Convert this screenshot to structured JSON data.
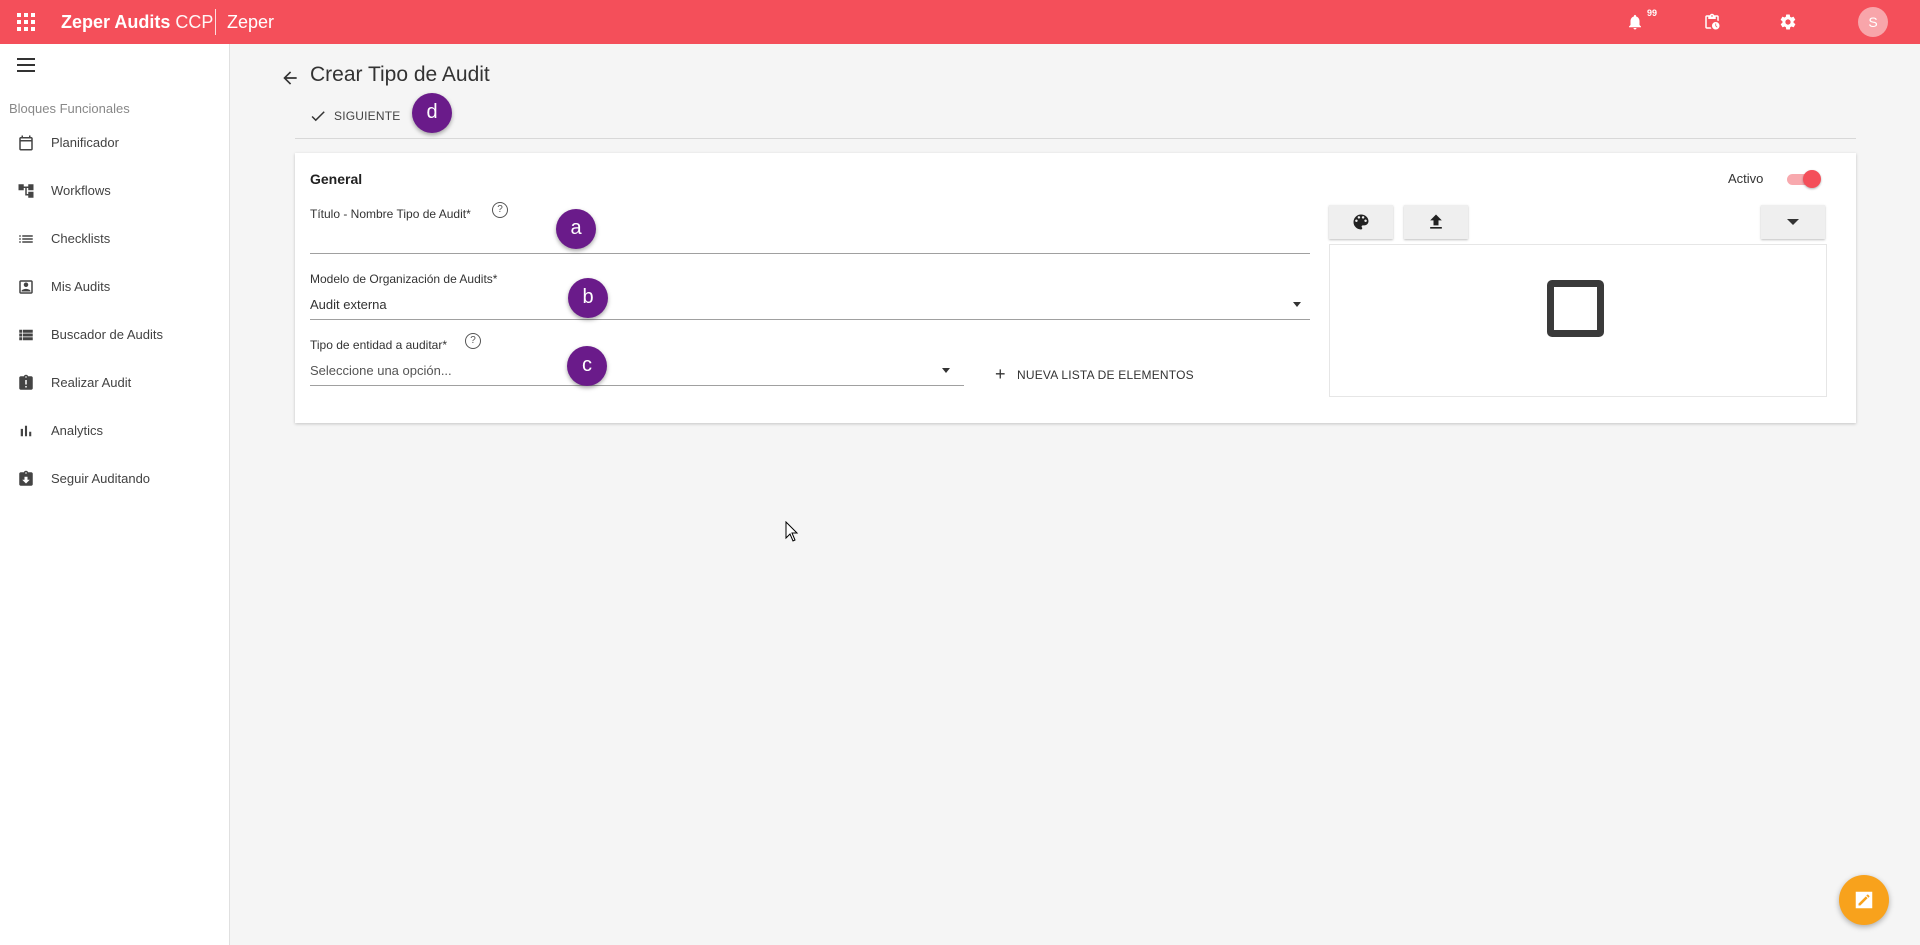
{
  "topbar": {
    "brand_bold": "Zeper Audits",
    "brand_suffix": "CCP",
    "org": "Zeper",
    "notification_count": "99",
    "avatar_initial": "S"
  },
  "sidebar": {
    "section_title": "Bloques Funcionales",
    "items": [
      {
        "label": "Planificador",
        "icon": "calendar-icon"
      },
      {
        "label": "Workflows",
        "icon": "workflow-icon"
      },
      {
        "label": "Checklists",
        "icon": "list-icon"
      },
      {
        "label": "Mis Audits",
        "icon": "contact-card-icon"
      },
      {
        "label": "Buscador de Audits",
        "icon": "search-list-icon"
      },
      {
        "label": "Realizar Audit",
        "icon": "clipboard-alert-icon"
      },
      {
        "label": "Analytics",
        "icon": "bar-chart-icon"
      },
      {
        "label": "Seguir Auditando",
        "icon": "clipboard-download-icon"
      }
    ]
  },
  "page": {
    "title": "Crear Tipo de Audit",
    "next_label": "SIGUIENTE"
  },
  "card": {
    "title": "General",
    "active_label": "Activo",
    "active": true,
    "fields": {
      "title": {
        "label": "Título - Nombre Tipo de Audit*",
        "value": ""
      },
      "model": {
        "label": "Modelo de Organización de Audits*",
        "value": "Audit externa"
      },
      "entity": {
        "label": "Tipo de entidad a auditar*",
        "placeholder": "Seleccione una opción..."
      }
    },
    "new_list_label": "NUEVA LISTA DE ELEMENTOS"
  },
  "markers": {
    "a": "a",
    "b": "b",
    "c": "c",
    "d": "d"
  },
  "colors": {
    "brand": "#f44f5a",
    "marker": "#6a1b8a",
    "fab": "#f8a21c"
  }
}
